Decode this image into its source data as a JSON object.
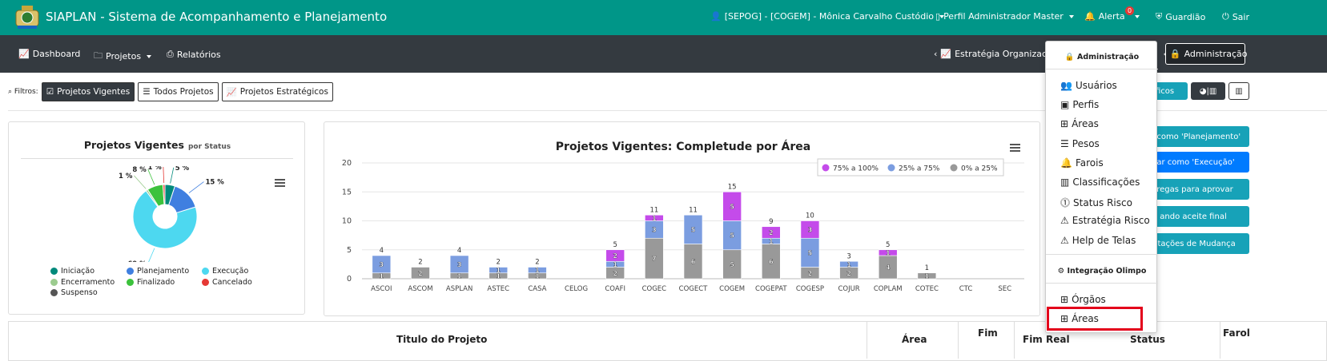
{
  "header": {
    "app_title": "SIAPLAN - Sistema de Acompanhamento e Planejamento",
    "user": "[SEPOG] - [COGEM] - Mônica Carvalho Custódio",
    "profile": "Perfil Administrador Master",
    "alert_label": "Alerta",
    "alert_count": "0",
    "guardiao": "Guardião",
    "sair": "Sair"
  },
  "nav": {
    "dashboard": "Dashboard",
    "projetos": "Projetos",
    "relatorios": "Relatórios",
    "estrategia": "Estratégia Organizacior",
    "administracao": "Administração"
  },
  "filters": {
    "label": "Filtros:",
    "vigentes": "Projetos Vigentes",
    "todos": "Todos Projetos",
    "estrategicos": "Projetos Estratégicos"
  },
  "right_buttons": {
    "graficos": "áficos",
    "r1": "ar como 'Planejamento'",
    "r2": "var como 'Execução'",
    "r3": "tregas para aprovar",
    "r4": "ando aceite final",
    "r5": "citações de Mudança"
  },
  "pie_card": {
    "title": "Projetos Vigentes",
    "subtitle": "por Status"
  },
  "pie_chart": {
    "type": "pie",
    "title": "Projetos Vigentes",
    "subtitle": "por Status",
    "slices": [
      {
        "name": "Iniciação",
        "pct": 5,
        "label": "5 %",
        "color": "#00897b"
      },
      {
        "name": "Planejamento",
        "pct": 15,
        "label": "15 %",
        "color": "#3f7fe0"
      },
      {
        "name": "Execução",
        "pct": 69,
        "label": "69 %",
        "color": "#4dd8f0"
      },
      {
        "name": "Encerramento",
        "pct": 1,
        "label": "1 %",
        "color": "#9ccc8f"
      },
      {
        "name": "Finalizado",
        "pct": 8,
        "label": "8 %",
        "color": "#3cc23c"
      },
      {
        "name": "Cancelado",
        "pct": 1,
        "label": "1 %",
        "color": "#e53935"
      },
      {
        "name": "Suspenso",
        "pct": 0,
        "label": "",
        "color": "#555555"
      }
    ]
  },
  "chart_data": {
    "type": "bar",
    "title": "Projetos Vigentes: Completude por Área",
    "categories": [
      "ASCOI",
      "ASCOM",
      "ASPLAN",
      "ASTEC",
      "CASA",
      "CELOG",
      "COAFI",
      "COGEC",
      "COGECT",
      "COGEM",
      "COGEPAT",
      "COGESP",
      "COJUR",
      "COPLAM",
      "COTEC",
      "CTC",
      "SEC"
    ],
    "ylim": [
      0,
      20
    ],
    "yticks": [
      0,
      5,
      10,
      15,
      20
    ],
    "legend_position": "top-right",
    "series": [
      {
        "name": "0% a 25%",
        "color": "#999999",
        "values": [
          1,
          2,
          1,
          1,
          1,
          0,
          2,
          7,
          6,
          5,
          6,
          2,
          2,
          4,
          1,
          0,
          0
        ]
      },
      {
        "name": "25% a 75%",
        "color": "#7b9de0",
        "values": [
          3,
          0,
          3,
          1,
          1,
          0,
          1,
          3,
          5,
          5,
          1,
          5,
          1,
          0,
          0,
          0,
          0
        ]
      },
      {
        "name": "75% a 100%",
        "color": "#c44bea",
        "values": [
          0,
          0,
          0,
          0,
          0,
          0,
          2,
          1,
          0,
          5,
          2,
          3,
          0,
          1,
          0,
          0,
          0
        ]
      }
    ],
    "totals": [
      "4",
      "2",
      "4",
      "2",
      "2",
      "",
      "5",
      "11",
      "11",
      "15",
      "9",
      "10",
      "3",
      "5",
      "1",
      "",
      ""
    ]
  },
  "dropdown": {
    "admin_header": "Administração",
    "items": [
      "Usuários",
      "Perfis",
      "Áreas",
      "Pesos",
      "Farois",
      "Classificações",
      "Status Risco",
      "Estratégia Risco",
      "Help de Telas"
    ],
    "integ_header": "Integração Olimpo",
    "integ_items": [
      "Órgãos",
      "Áreas"
    ]
  },
  "table": {
    "col_titulo": "Titulo do Projeto",
    "col_area": "Área",
    "col_fim": "Fim",
    "col_fim_real": "Fim Real",
    "col_status": "Status",
    "col_farol": "Farol"
  }
}
